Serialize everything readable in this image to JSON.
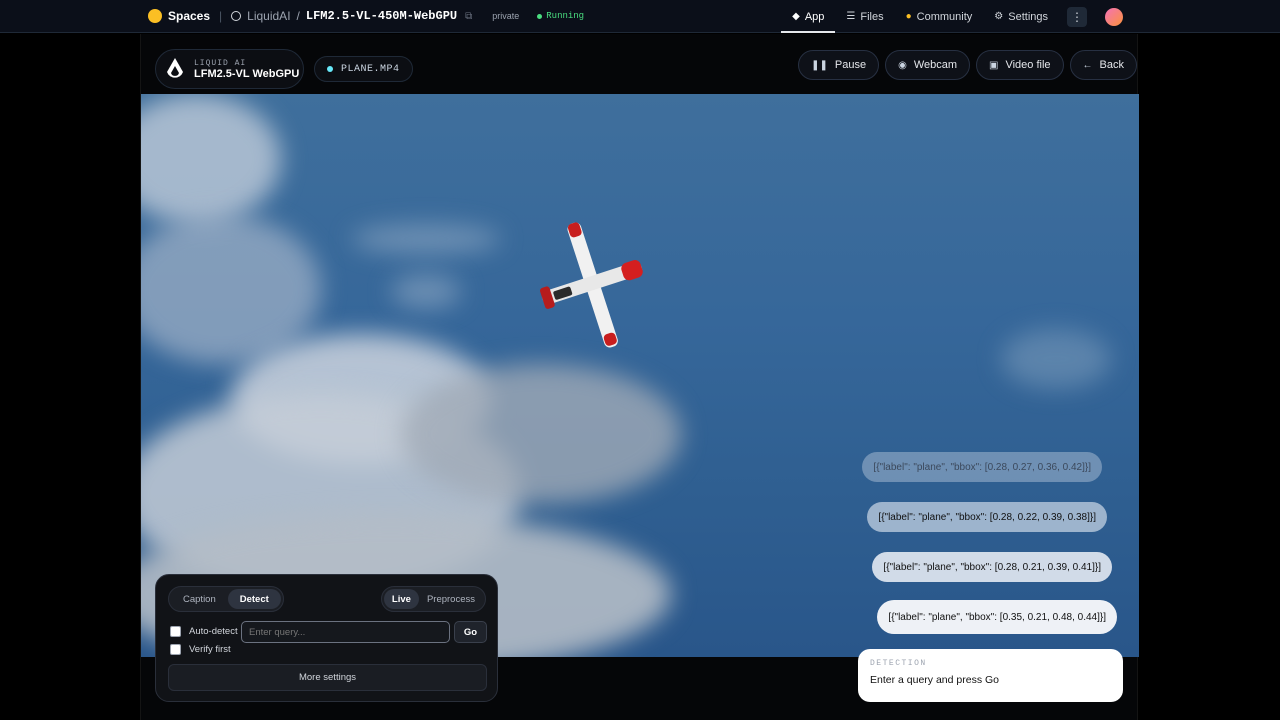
{
  "hf": {
    "spaces_label": "Spaces",
    "org": "LiquidAI",
    "separator": "/",
    "repo": "LFM2.5-VL-450M-WebGPU",
    "visibility": "private",
    "status": "Running",
    "tabs": [
      {
        "label": "App",
        "icon": "cube-icon",
        "active": true
      },
      {
        "label": "Files",
        "icon": "files-icon"
      },
      {
        "label": "Community",
        "icon": "community-icon"
      },
      {
        "label": "Settings",
        "icon": "gear-icon"
      }
    ]
  },
  "header": {
    "brand_small": "LIQUID AI",
    "brand_name": "LFM2.5-VL WebGPU",
    "source": "PLANE.MP4",
    "buttons": [
      {
        "label": "Pause",
        "icon": "pause-icon"
      },
      {
        "label": "Webcam",
        "icon": "camera-icon"
      },
      {
        "label": "Video file",
        "icon": "film-icon"
      },
      {
        "label": "Back",
        "icon": "arrow-left-icon"
      }
    ]
  },
  "detections": [
    "[{\"label\": \"plane\", \"bbox\": [0.28, 0.27, 0.36, 0.42]}]",
    "[{\"label\": \"plane\", \"bbox\": [0.28, 0.22, 0.39, 0.38]}]",
    "[{\"label\": \"plane\", \"bbox\": [0.28, 0.21, 0.39, 0.41]}]",
    "[{\"label\": \"plane\", \"bbox\": [0.35, 0.21, 0.48, 0.44]}]"
  ],
  "controls": {
    "mode_tabs": [
      "Caption",
      "Detect"
    ],
    "active_mode": "Detect",
    "run_tabs": [
      "Live",
      "Preprocess"
    ],
    "active_run": "Live",
    "auto_detect_label": "Auto-detect",
    "verify_label": "Verify first",
    "query_placeholder": "Enter query...",
    "go_label": "Go",
    "more_settings_label": "More settings"
  },
  "detection_card": {
    "label": "DETECTION",
    "text": "Enter a query and press Go"
  },
  "colors": {
    "accent_running": "#4ade80",
    "source_dot": "#67e8f9",
    "sky": "#36679a"
  }
}
